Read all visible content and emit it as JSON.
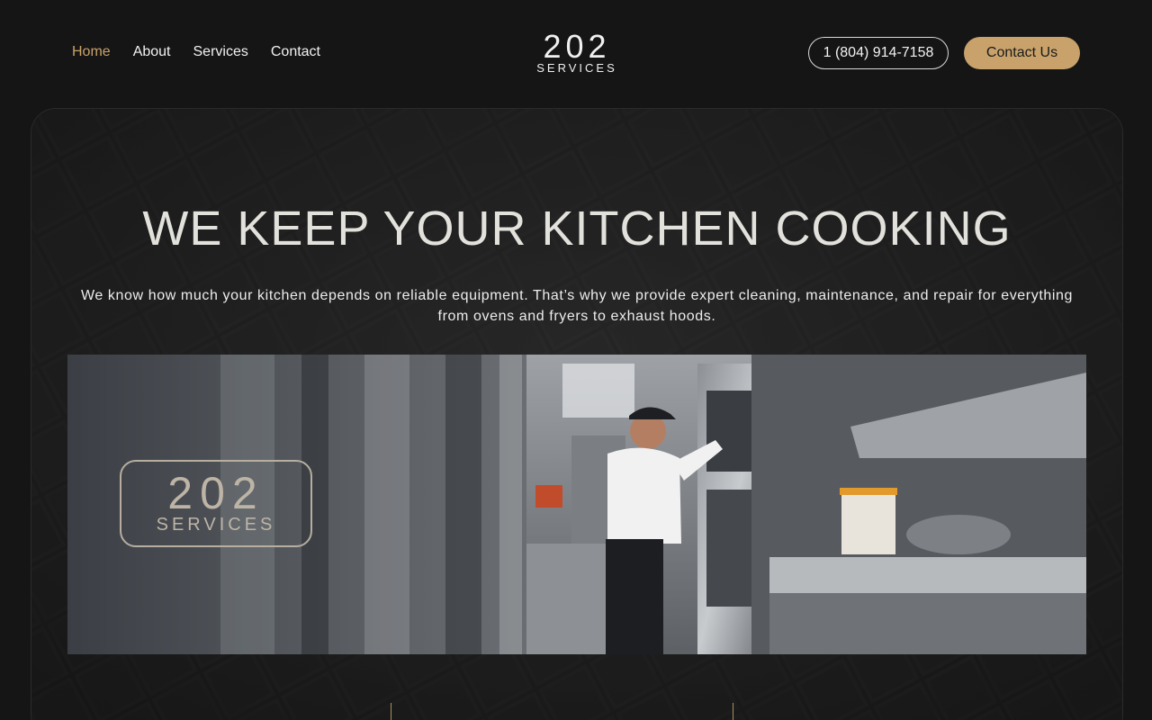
{
  "nav": {
    "items": [
      {
        "label": "Home",
        "active": true
      },
      {
        "label": "About",
        "active": false
      },
      {
        "label": "Services",
        "active": false
      },
      {
        "label": "Contact",
        "active": false
      }
    ]
  },
  "logo": {
    "number": "202",
    "word": "SERVICES"
  },
  "header": {
    "phone": "1 (804) 914-7158",
    "cta_label": "Contact Us"
  },
  "hero": {
    "title": "WE KEEP YOUR KITCHEN COOKING",
    "subtitle": "We know how much your kitchen depends on reliable equipment. That’s why we provide expert cleaning, maintenance, and repair for everything from ovens and fryers to exhaust hoods.",
    "image_logo": {
      "number": "202",
      "word": "SERVICES"
    }
  },
  "colors": {
    "accent": "#c9a26b",
    "background": "#151515",
    "text": "#e6e3de"
  }
}
